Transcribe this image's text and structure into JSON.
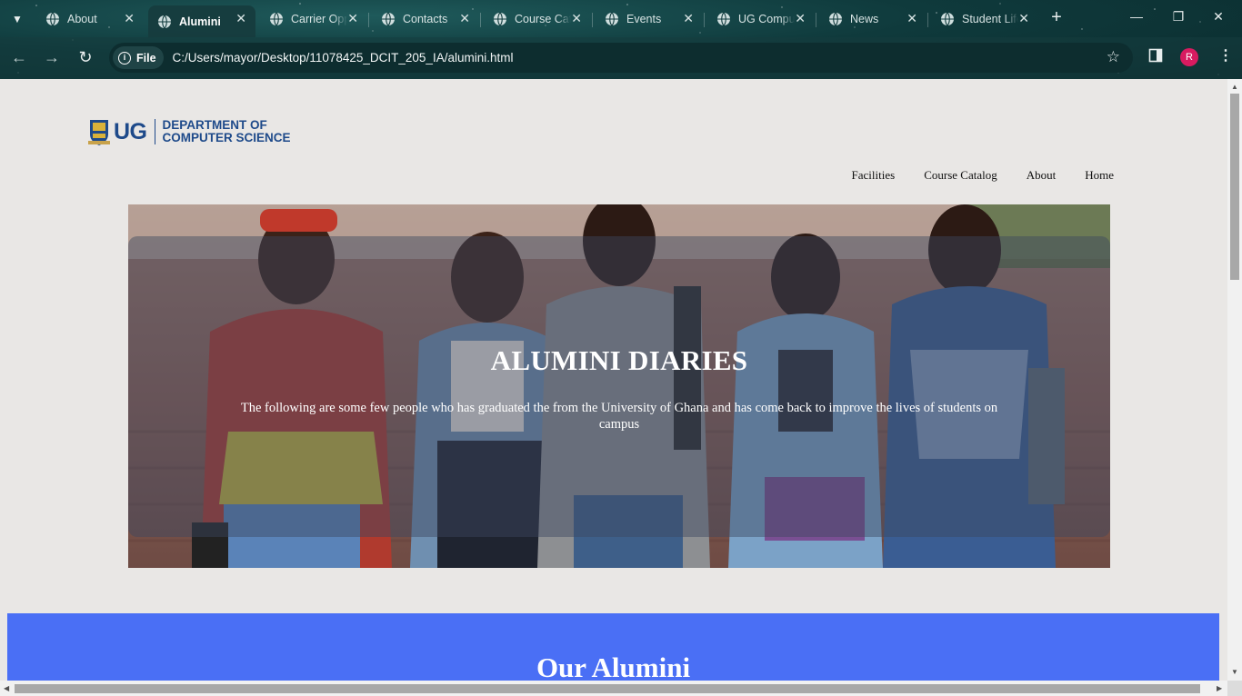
{
  "browser": {
    "tabs": [
      {
        "label": "About",
        "active": false
      },
      {
        "label": "Alumini",
        "active": true
      },
      {
        "label": "Carrier Opportunities",
        "active": false
      },
      {
        "label": "Contacts",
        "active": false
      },
      {
        "label": "Course Catalog",
        "active": false
      },
      {
        "label": "Events",
        "active": false
      },
      {
        "label": "UG Computer Science",
        "active": false
      },
      {
        "label": "News",
        "active": false
      },
      {
        "label": "Student Life",
        "active": false
      }
    ],
    "site_chip": "File",
    "url": "C:/Users/mayor/Desktop/11078425_DCIT_205_IA/alumini.html",
    "profile_initial": "R",
    "accent": "#0f3a3c"
  },
  "page": {
    "logo": {
      "ug": "UG",
      "dept_line1": "DEPARTMENT OF",
      "dept_line2": "COMPUTER SCIENCE"
    },
    "nav": [
      "Facilities",
      "Course Catalog",
      "About",
      "Home"
    ],
    "hero": {
      "title": "ALUMINI DIARIES",
      "text": "The following are some few people who has graduated the from the University of Ghana and has come back to improve the lives of students on campus"
    },
    "section_title": "Our Alumini",
    "section_color": "#4a6ff5"
  }
}
